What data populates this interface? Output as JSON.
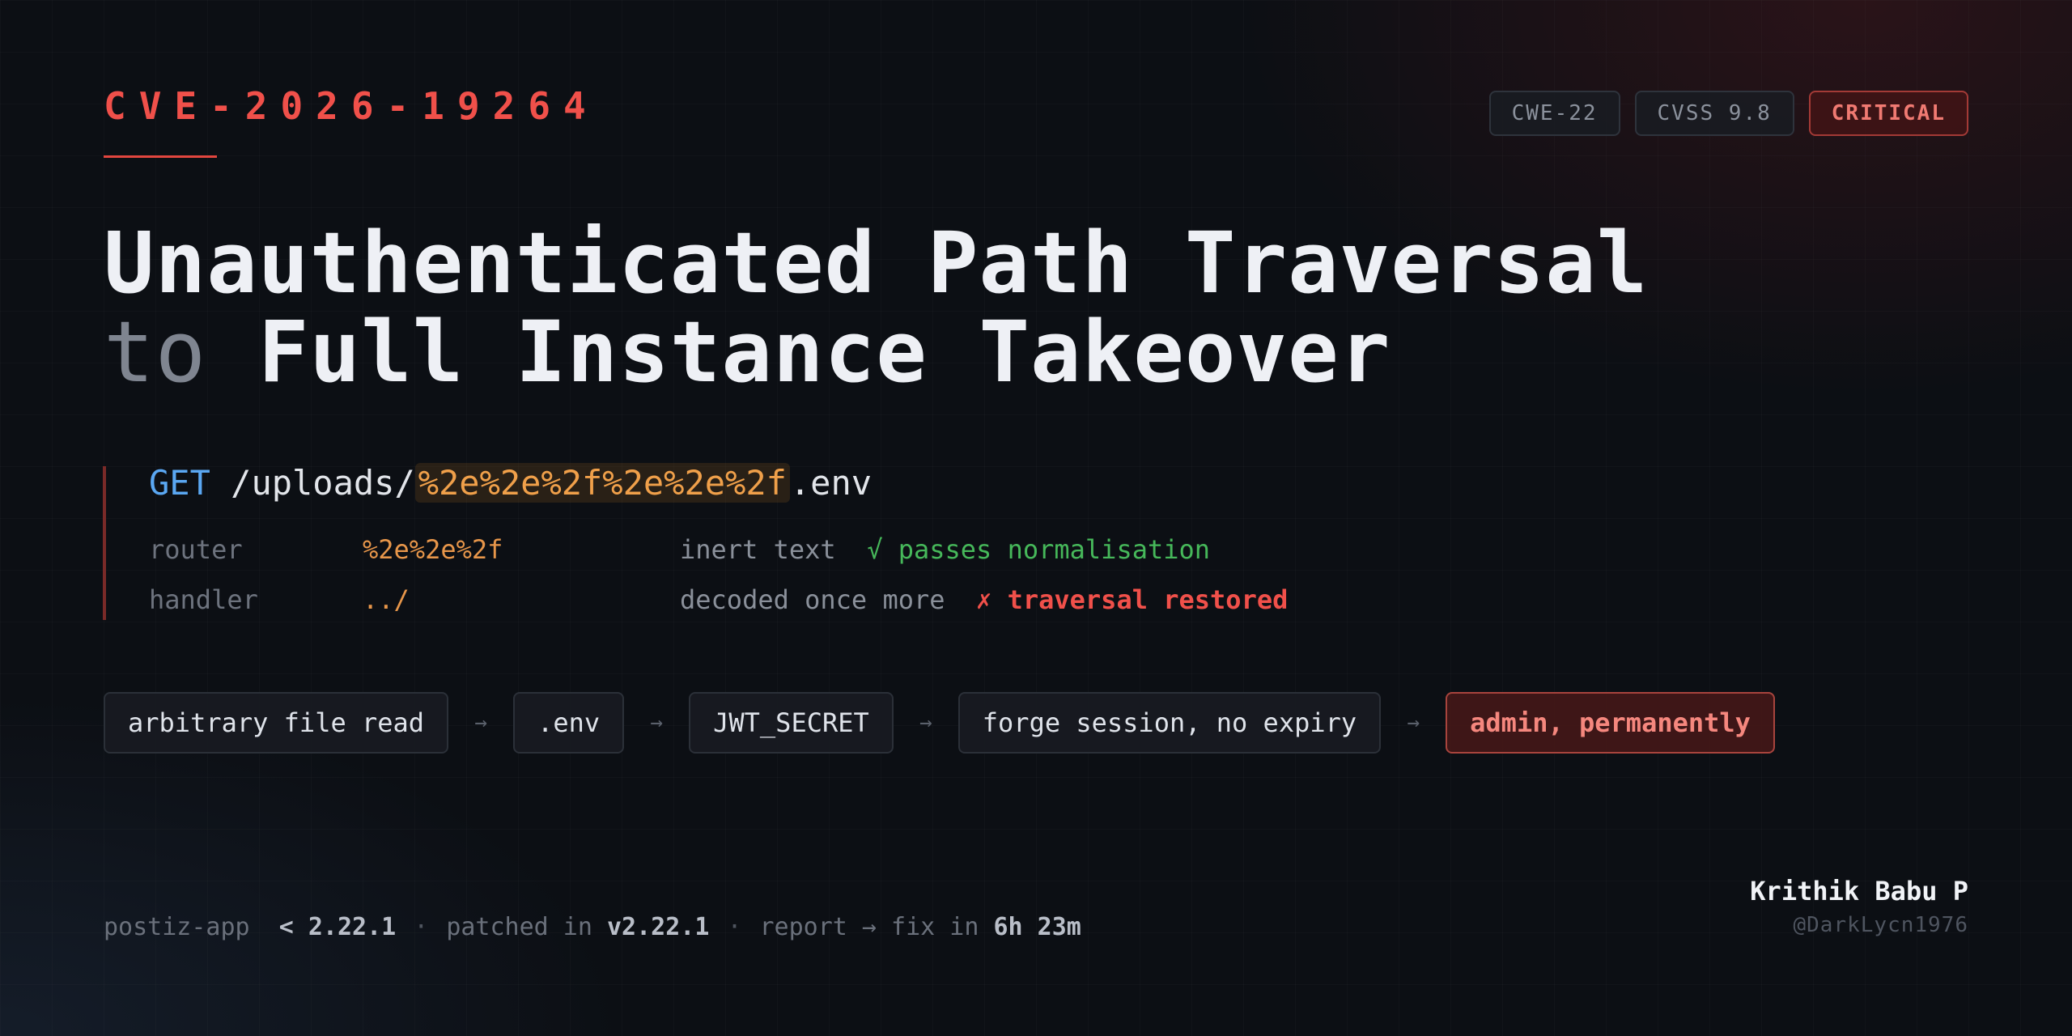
{
  "cve_id": "CVE-2026-19264",
  "badges": {
    "cwe": "CWE-22",
    "cvss": "CVSS 9.8",
    "severity": "CRITICAL"
  },
  "headline": {
    "line1": "Unauthenticated Path Traversal",
    "line2_prefix": "to",
    "line2_rest": "Full Instance Takeover"
  },
  "request": {
    "method": "GET",
    "path_prefix": "/uploads/",
    "payload": "%2e%2e%2f%2e%2e%2f",
    "suffix": ".env"
  },
  "decode_rows": [
    {
      "stage": "router",
      "value": "%2e%2e%2f",
      "note": "inert text",
      "result_mark": "√",
      "result": "passes normalisation"
    },
    {
      "stage": "handler",
      "value": "../",
      "note": "decoded once more",
      "result_mark": "✗",
      "result": "traversal restored"
    }
  ],
  "chain": {
    "steps": [
      "arbitrary file read",
      ".env",
      "JWT_SECRET",
      "forge session, no expiry",
      "admin, permanently"
    ],
    "arrow": "→"
  },
  "footer": {
    "app": "postiz-app",
    "affected_prefix": "<",
    "affected_version": "2.22.1",
    "separator": "·",
    "patched_label": "patched in",
    "patched_version": "v2.22.1",
    "timeline_label": "report → fix in",
    "timeline_value": "6h 23m"
  },
  "author": {
    "name": "Krithik Babu P",
    "handle": "@DarkLycn1976"
  },
  "colors": {
    "accent_red": "#f0504a",
    "payload_orange": "#f0a04a",
    "method_blue": "#5aa7f2",
    "ok_green": "#46b85a"
  }
}
